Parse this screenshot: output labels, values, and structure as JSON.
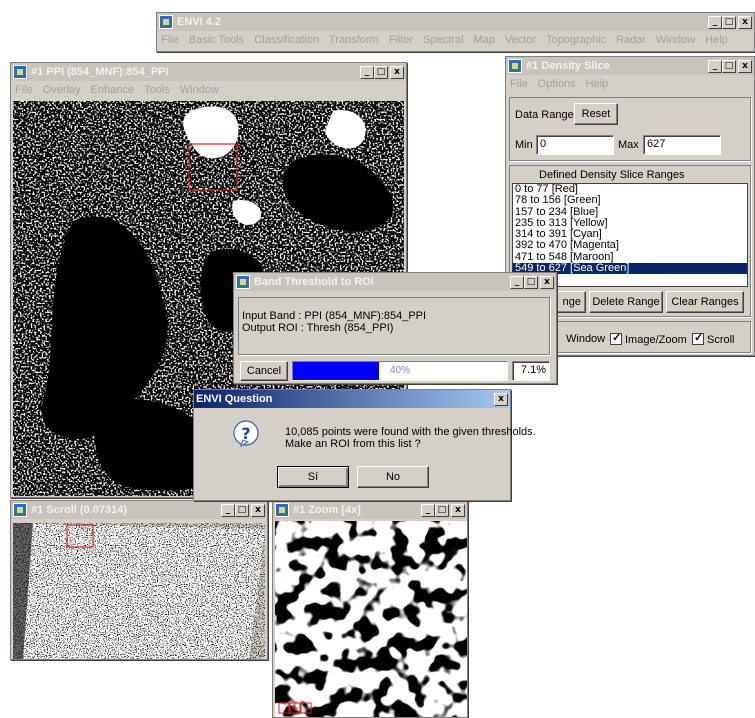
{
  "main_window": {
    "title": "ENVI 4.2",
    "menus": [
      "File",
      "Basic Tools",
      "Classification",
      "Transform",
      "Filter",
      "Spectral",
      "Map",
      "Vector",
      "Topographic",
      "Radar",
      "Window",
      "Help"
    ]
  },
  "image_window": {
    "title": "#1 PPI (854_MNF):854_PPI",
    "menus": [
      "File",
      "Overlay",
      "Enhance",
      "Tools",
      "Window"
    ]
  },
  "density_slice": {
    "title": "#1 Density Slice",
    "menus": [
      "File",
      "Options",
      "Help"
    ],
    "data_range_label": "Data Range",
    "reset_label": "Reset",
    "min_label": "Min",
    "min_value": "0",
    "max_label": "Max",
    "max_value": "627",
    "ranges_header": "Defined Density Slice Ranges",
    "ranges": [
      "0 to 77 [Red]",
      "78 to 156 [Green]",
      "157 to 234 [Blue]",
      "235 to 313 [Yellow]",
      "314 to 391 [Cyan]",
      "392 to 470 [Magenta]",
      "471 to 548 [Maroon]",
      "549 to 627 [Sea Green]"
    ],
    "selected_range_visible": "7 [Sea Green]",
    "add_range_visible": "nge",
    "delete_range_label": "Delete Range",
    "clear_ranges_label": "Clear Ranges",
    "window_label": "Window",
    "image_zoom_label": "Image/Zoom",
    "scroll_label": "Scroll"
  },
  "band_threshold": {
    "title": "Band Threshold to ROI",
    "input_band": "Input Band : PPI (854_MNF):854_PPI",
    "output_roi": "Output ROI : Thresh (854_PPI)",
    "cancel_label": "Cancel",
    "progress": 0.4,
    "progress_text": "40%",
    "percent_text": "7.1%"
  },
  "question_dialog": {
    "title": "ENVI Question",
    "message_line1": "10,085 points were found with the given thresholds.",
    "message_line2": "Make an ROI from this list ?",
    "yes_label": "Sí",
    "no_label": "No"
  },
  "scroll_window": {
    "title": "#1 Scroll (0.07314)"
  },
  "zoom_window": {
    "title": "#1 Zoom [4x]"
  },
  "colors": {
    "selection": "#0a246a",
    "progress": "#0000ff",
    "roi_box": "#e02020"
  }
}
